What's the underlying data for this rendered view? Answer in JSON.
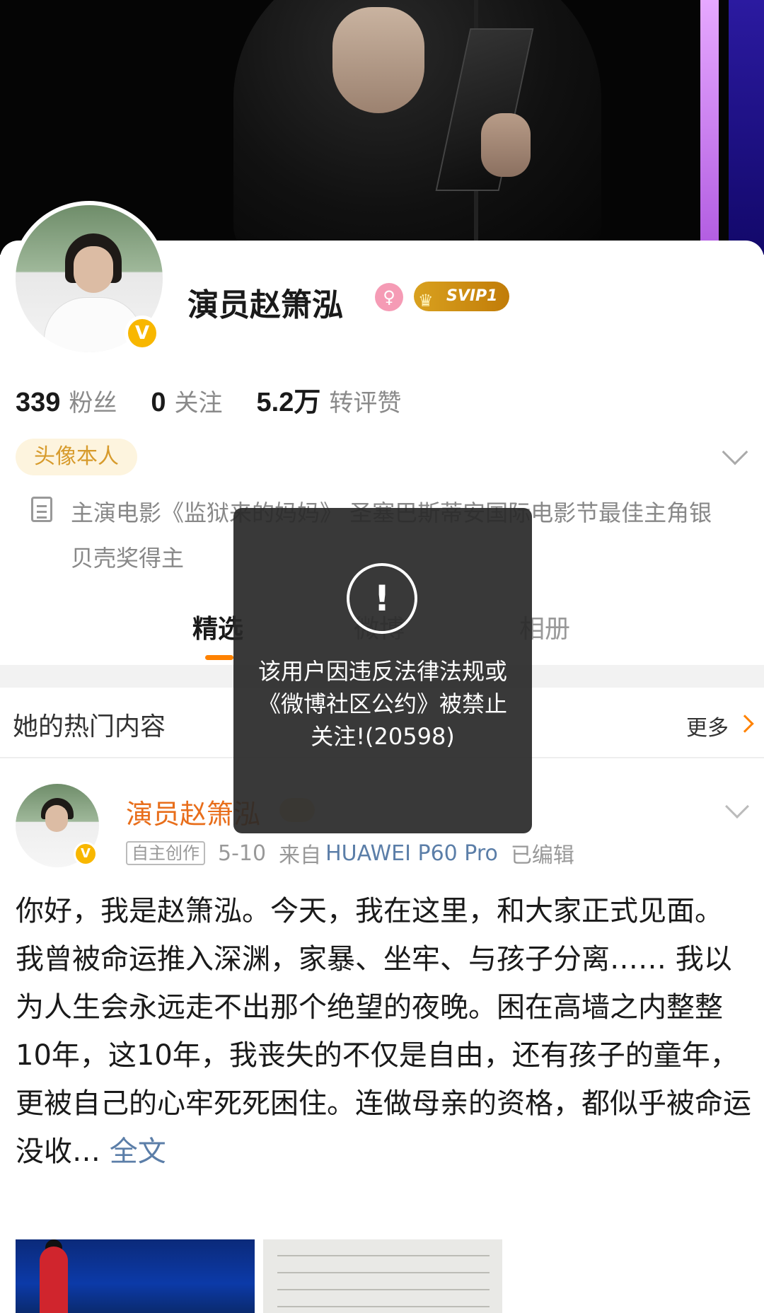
{
  "profile": {
    "name": "演员赵箫泓",
    "vip_label": "SVIP1",
    "verified_mark": "V",
    "stats": [
      {
        "value": "339",
        "label": "粉丝"
      },
      {
        "value": "0",
        "label": "关注"
      },
      {
        "value": "5.2万",
        "label": "转评赞"
      }
    ],
    "tag": "头像本人",
    "bio": "主演电影《监狱来的妈妈》 圣塞巴斯蒂安国际电影节最佳主角银贝壳奖得主"
  },
  "tabs": [
    "精选",
    "微博",
    "相册"
  ],
  "hot_section": {
    "title": "她的热门内容",
    "more_label": "更多"
  },
  "post": {
    "author": "演员赵箫泓",
    "tag": "自主创作",
    "date": "5-10",
    "source_prefix": "来自",
    "source": "HUAWEI P60 Pro",
    "edited": "已编辑",
    "paragraphs": [
      "你好，我是赵箫泓。今天，我在这里，和大家正式见面。",
      "我曾被命运推入深渊，家暴、坐牢、与孩子分离…… 我以为人生会永远走不出那个绝望的夜晚。困在高墙之内整整10年，这10年，我丧失的不仅是自由，还有孩子的童年，更被自己的心牢死死困住。连做母亲的资格，都似乎被命运没收…"
    ],
    "more_link": "全文"
  },
  "toast": {
    "icon_char": "!",
    "message": "该用户因违反法律法规或《微博社区公约》被禁止关注!(20598)"
  },
  "colors": {
    "accent": "#ff8200",
    "link": "#5b7ea8",
    "author": "#e86e1b",
    "verified": "#f8b700"
  }
}
